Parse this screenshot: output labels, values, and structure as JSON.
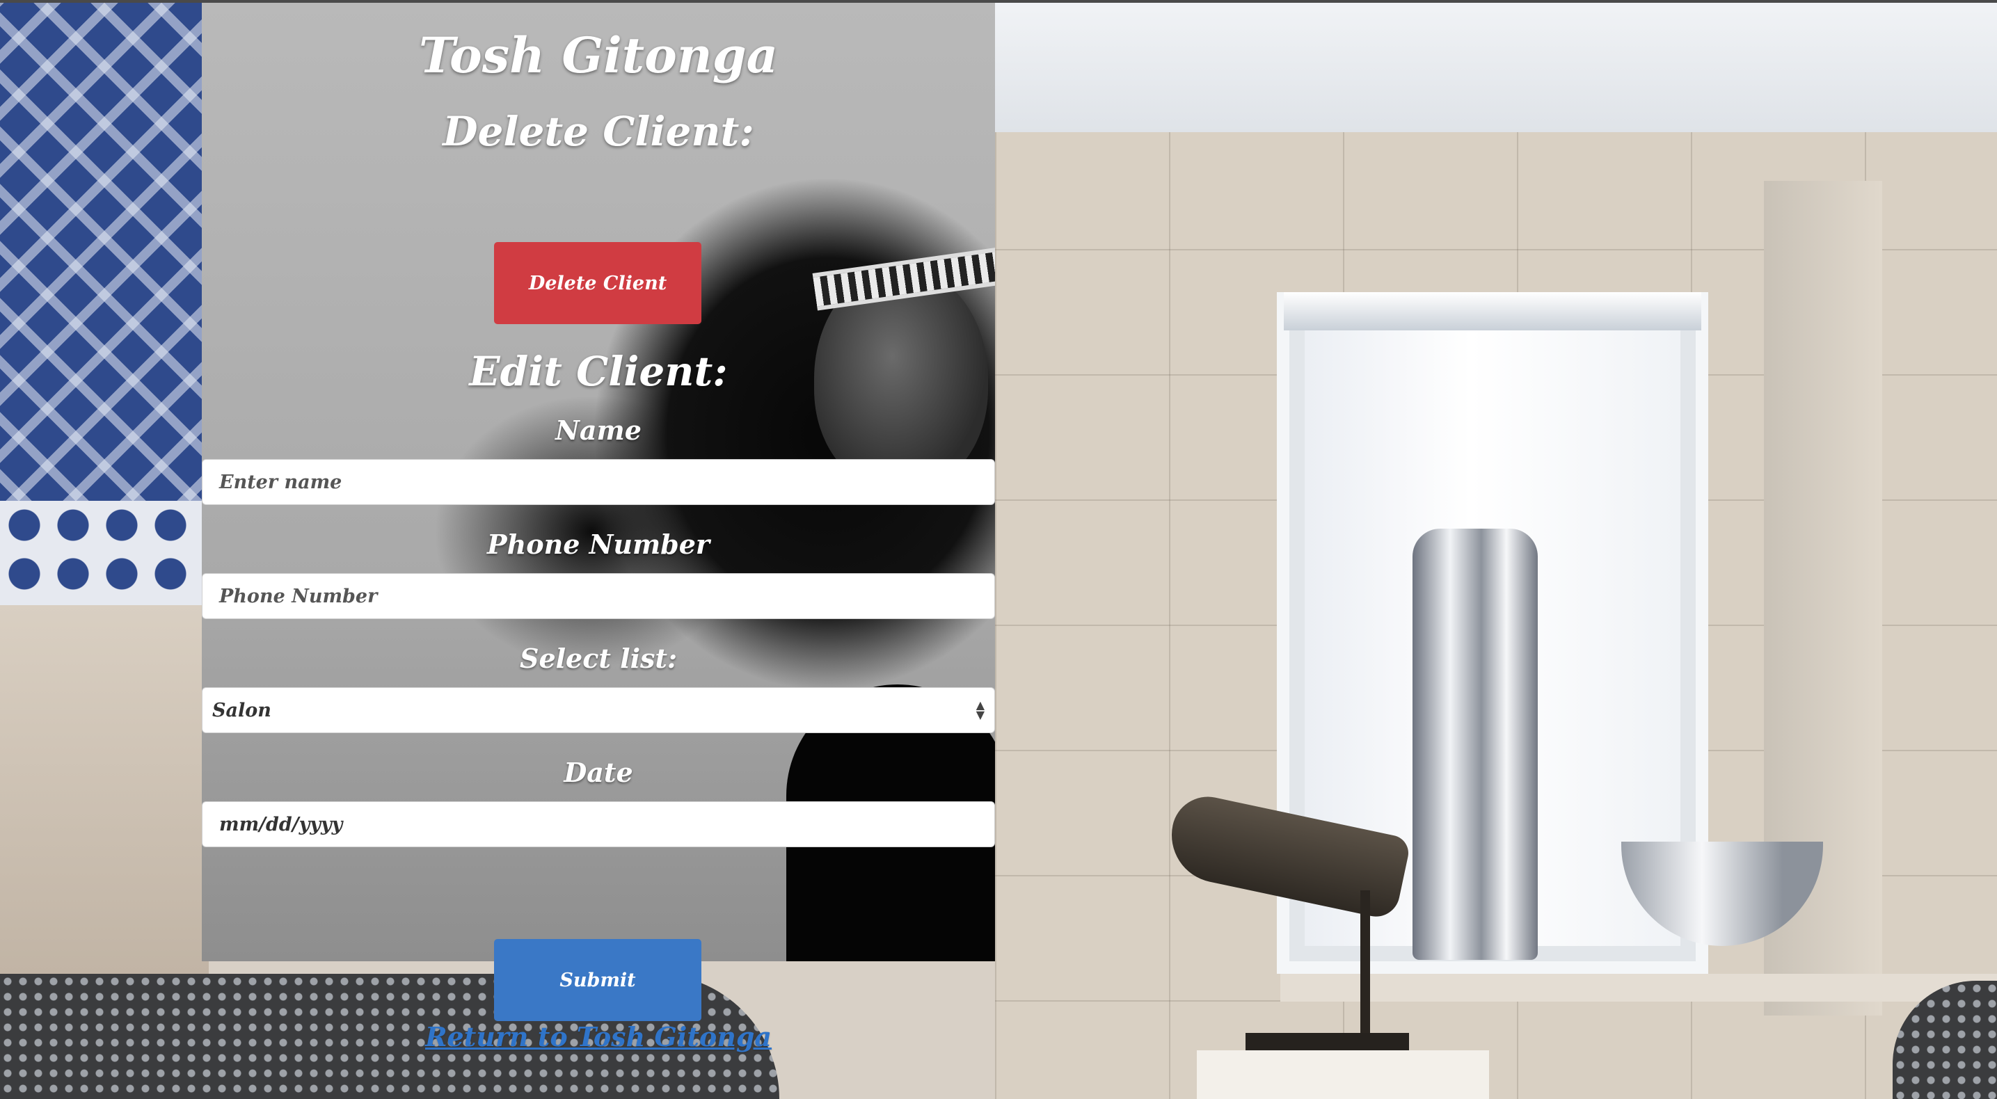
{
  "site_title": "Tosh Gitonga",
  "delete_section": {
    "heading": "Delete Client:",
    "button_label": "Delete Client"
  },
  "edit_section": {
    "heading": "Edit Client:",
    "name": {
      "label": "Name",
      "placeholder": "Enter name"
    },
    "phone": {
      "label": "Phone Number",
      "placeholder": "Phone Number"
    },
    "list": {
      "label": "Select list:",
      "selected": "Salon"
    },
    "date": {
      "label": "Date",
      "placeholder": "mm/dd/yyyy"
    },
    "submit_label": "Submit"
  },
  "return_link": "Return to Tosh Gitonga",
  "colors": {
    "delete_button": "#d03c42",
    "submit_button": "#3a78c6",
    "link": "#2f74c9",
    "heading_text": "#ffffff"
  }
}
